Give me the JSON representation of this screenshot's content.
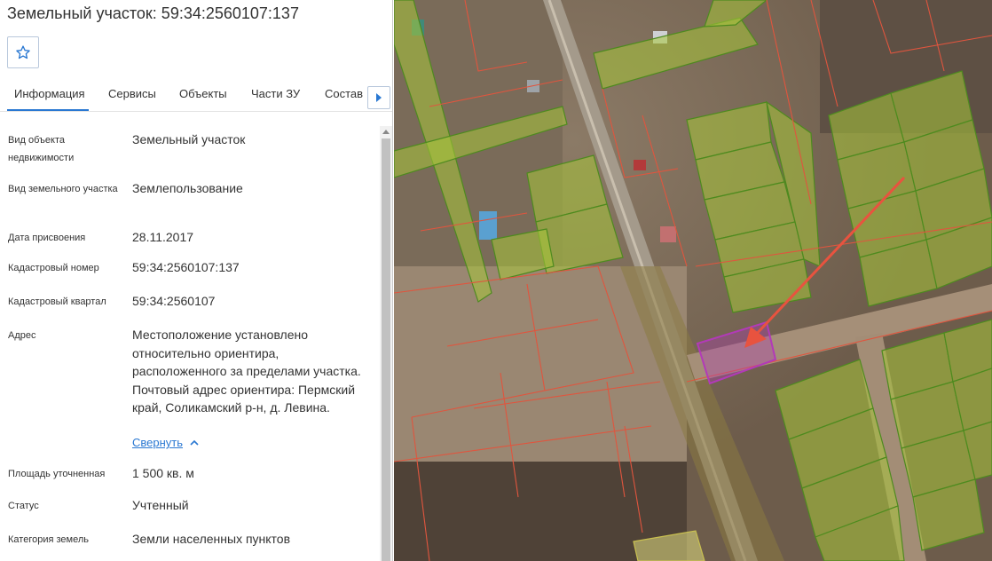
{
  "header": {
    "title": "Земельный участок: 59:34:2560107:137"
  },
  "tabs": [
    {
      "label": "Информация",
      "active": true
    },
    {
      "label": "Сервисы"
    },
    {
      "label": "Объекты"
    },
    {
      "label": "Части ЗУ"
    },
    {
      "label": "Состав"
    }
  ],
  "properties": [
    {
      "label": "Вид объекта недвижимости",
      "value": "Земельный участок"
    },
    {
      "label": "Вид земельного участка",
      "value": "Землепользование"
    },
    {
      "label": "Дата присвоения",
      "value": "28.11.2017"
    },
    {
      "label": "Кадастровый номер",
      "value": "59:34:2560107:137"
    },
    {
      "label": "Кадастровый квартал",
      "value": "59:34:2560107"
    },
    {
      "label": "Адрес",
      "value": "Местоположение установлено относительно ориентира, расположенного за пределами участка. Почтовый адрес ориентира: Пермский край, Соликамский р-н, д. Левина."
    },
    {
      "label": "Площадь уточненная",
      "value": "1 500 кв. м"
    },
    {
      "label": "Статус",
      "value": "Учтенный"
    },
    {
      "label": "Категория земель",
      "value": "Земли населенных пунктов"
    }
  ],
  "address_toggle": {
    "label": "Свернуть"
  },
  "icons": {
    "favorite": "star-outline-icon",
    "tabs_next": "chevron-right-icon",
    "collapse": "chevron-up-icon"
  },
  "colors": {
    "accent": "#2a78d2",
    "parcel_green": "#a8c63a",
    "parcel_border_red": "#e0553e",
    "selected_parcel": "#b23ab8"
  }
}
